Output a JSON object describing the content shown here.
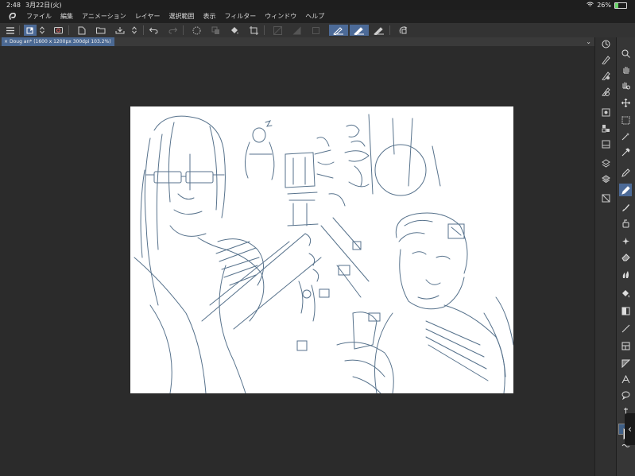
{
  "status_bar": {
    "time": "2:48",
    "date": "3月22日(火)",
    "battery_percent": "26%",
    "battery_level": 0.26
  },
  "menu": {
    "items": [
      "ファイル",
      "編集",
      "アニメーション",
      "レイヤー",
      "選択範囲",
      "表示",
      "フィルター",
      "ウィンドウ",
      "ヘルプ"
    ]
  },
  "document": {
    "tab_label": "Doug an* (1600 x 1200px 300dpi 103.2%)"
  },
  "colors": {
    "accent": "#4c6a97",
    "main_color": "#3f5f86",
    "sub_color": "#ffffff",
    "sketch_ink": "#3a5a78"
  },
  "icons": {
    "toolbar": [
      "menu-icon",
      "new-layer-icon",
      "reorder-icon",
      "camera-icon",
      "new-file-icon",
      "open-icon",
      "save-icon",
      "reorder-icon",
      "undo-icon",
      "redo-icon",
      "clear-selection-icon",
      "crop-icon",
      "fill-icon",
      "transform-icon",
      "dimmed-icon",
      "dimmed-icon",
      "dimmed-icon",
      "pen-tool-icon",
      "pen-tool-icon",
      "pen-tool-icon",
      "rotate-icon"
    ],
    "tool_palette": [
      "zoom-icon",
      "hand-icon",
      "rotate-view-icon",
      "move-icon",
      "selection-icon",
      "magic-wand-icon",
      "eyedropper-icon",
      "pen-icon",
      "pencil-icon",
      "brush-icon",
      "airbrush-icon",
      "decoration-icon",
      "eraser-icon",
      "blend-icon",
      "fill-icon",
      "gradient-icon",
      "line-icon",
      "frame-icon",
      "ruler-icon",
      "text-icon",
      "balloon-icon",
      "correction-icon"
    ]
  }
}
